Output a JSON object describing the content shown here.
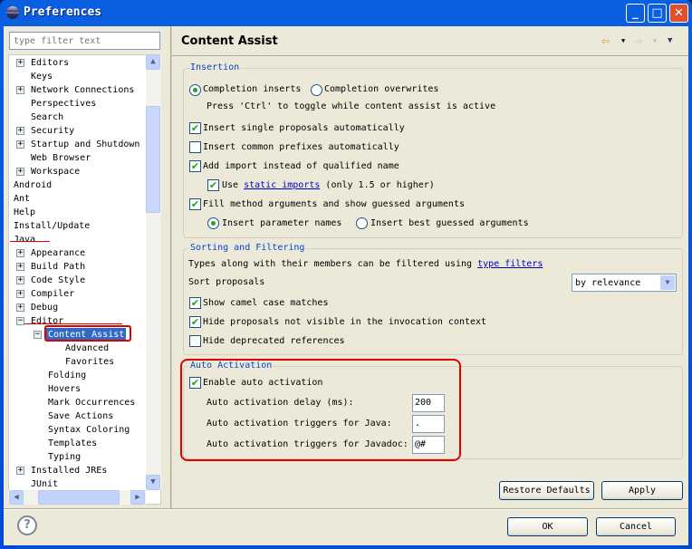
{
  "window": {
    "title": "Preferences",
    "minimize": "_",
    "maximize": "□",
    "close": "✕"
  },
  "filter": {
    "placeholder": "type filter text"
  },
  "tree": [
    {
      "label": "Editors",
      "level": 1,
      "expander": "+"
    },
    {
      "label": "Keys",
      "level": 1
    },
    {
      "label": "Network Connections",
      "level": 1,
      "expander": "+"
    },
    {
      "label": "Perspectives",
      "level": 1
    },
    {
      "label": "Search",
      "level": 1
    },
    {
      "label": "Security",
      "level": 1,
      "expander": "+"
    },
    {
      "label": "Startup and Shutdown",
      "level": 1,
      "expander": "+"
    },
    {
      "label": "Web Browser",
      "level": 1
    },
    {
      "label": "Workspace",
      "level": 1,
      "expander": "+"
    },
    {
      "label": "Android",
      "level": 0
    },
    {
      "label": "Ant",
      "level": 0
    },
    {
      "label": "Help",
      "level": 0
    },
    {
      "label": "Install/Update",
      "level": 0
    },
    {
      "label": "Java",
      "level": 0
    },
    {
      "label": "Appearance",
      "level": 1,
      "expander": "+"
    },
    {
      "label": "Build Path",
      "level": 1,
      "expander": "+"
    },
    {
      "label": "Code Style",
      "level": 1,
      "expander": "+"
    },
    {
      "label": "Compiler",
      "level": 1,
      "expander": "+"
    },
    {
      "label": "Debug",
      "level": 1,
      "expander": "+"
    },
    {
      "label": "Editor",
      "level": 1,
      "expander": "−"
    },
    {
      "label": "Content Assist",
      "level": 2,
      "expander": "−",
      "selected": true
    },
    {
      "label": "Advanced",
      "level": 3
    },
    {
      "label": "Favorites",
      "level": 3
    },
    {
      "label": "Folding",
      "level": 2
    },
    {
      "label": "Hovers",
      "level": 2
    },
    {
      "label": "Mark Occurrences",
      "level": 2
    },
    {
      "label": "Save Actions",
      "level": 2
    },
    {
      "label": "Syntax Coloring",
      "level": 2
    },
    {
      "label": "Templates",
      "level": 2
    },
    {
      "label": "Typing",
      "level": 2
    },
    {
      "label": "Installed JREs",
      "level": 1,
      "expander": "+"
    },
    {
      "label": "JUnit",
      "level": 1
    }
  ],
  "page": {
    "title": "Content Assist",
    "back_icon": "arrow-left-icon",
    "forward_icon": "arrow-right-icon",
    "menu_icon": "triangle-down-icon"
  },
  "insertion": {
    "title": "Insertion",
    "radio_inserts": "Completion inserts",
    "radio_overwrites": "Completion overwrites",
    "hint": "Press 'Ctrl' to toggle while content assist is active",
    "single": "Insert single proposals automatically",
    "prefixes": "Insert common prefixes automatically",
    "import": "Add import instead of qualified name",
    "use": "Use",
    "static_imports": "static imports",
    "only": "(only 1.5 or higher)",
    "fill": "Fill method arguments and show guessed arguments",
    "param_names": "Insert parameter names",
    "best_guessed": "Insert best guessed arguments"
  },
  "sorting": {
    "title": "Sorting and Filtering",
    "desc": "Types along with their members can be filtered using",
    "type_filters": "type filters",
    "sort_label": "Sort proposals",
    "sort_value": "by relevance",
    "camel": "Show camel case matches",
    "hide_invisible": "Hide proposals not visible in the invocation context",
    "hide_deprecated": "Hide deprecated references"
  },
  "auto": {
    "title": "Auto Activation",
    "enable": "Enable auto activation",
    "delay_label": "Auto activation delay (ms):",
    "delay": "200",
    "java_label": "Auto activation triggers for Java:",
    "java": ".",
    "javadoc_label": "Auto activation triggers for Javadoc:",
    "javadoc": "@#"
  },
  "buttons": {
    "restore": "Restore Defaults",
    "apply": "Apply",
    "ok": "OK",
    "cancel": "Cancel",
    "help": "?"
  },
  "colors": {
    "accent": "#0046d5",
    "annotation": "#e00000",
    "selection": "#316ac5"
  }
}
